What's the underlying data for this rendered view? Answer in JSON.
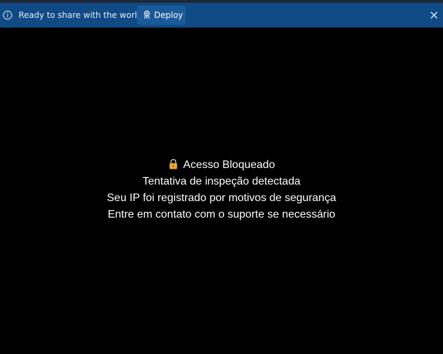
{
  "banner": {
    "icon": "info-icon",
    "message": "Ready to share with the world?",
    "deploy_button": {
      "icon": "deploy-icon",
      "label": "Deploy"
    },
    "close_icon": "close-icon",
    "background_color": "#0f4a85"
  },
  "main": {
    "background_color": "#000000",
    "lock_icon": "lock-icon",
    "title": "Acesso Bloqueado",
    "lines": [
      "Tentativa de inspeção detectada",
      "Seu IP foi registrado por motivos de segurança",
      "Entre em contato com o suporte se necessário"
    ]
  }
}
